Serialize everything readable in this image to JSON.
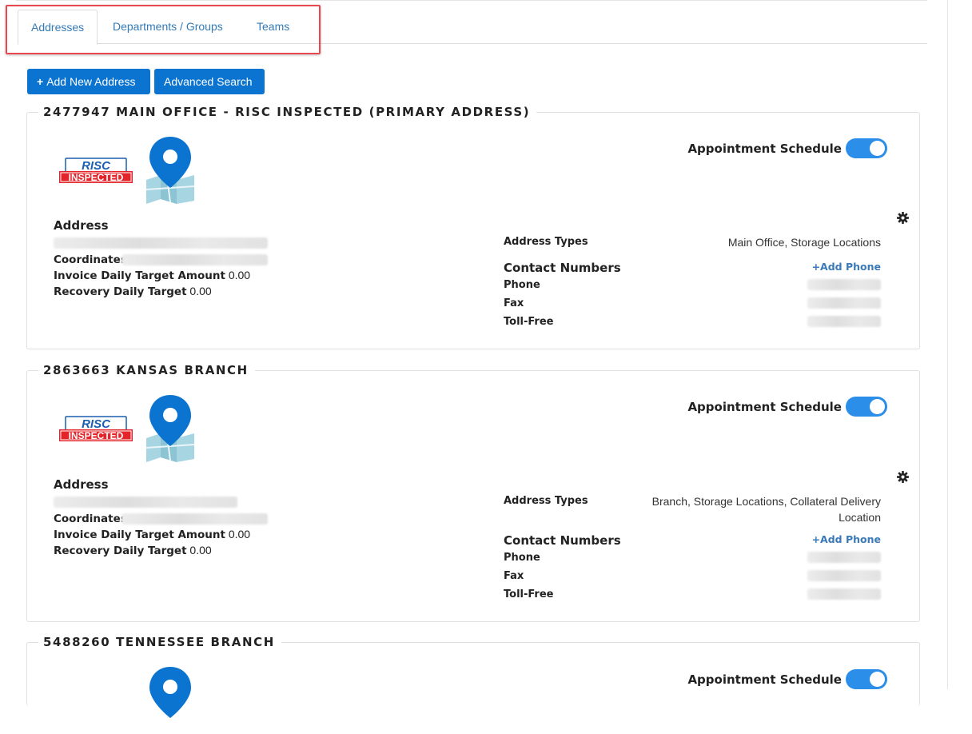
{
  "tabs": [
    {
      "label": "Addresses",
      "active": true
    },
    {
      "label": "Departments / Groups",
      "active": false
    },
    {
      "label": "Teams",
      "active": false
    }
  ],
  "toolbar": {
    "add_label": "Add New Address",
    "add_icon": "+",
    "search_label": "Advanced Search"
  },
  "colors": {
    "primary_button": "#0b74d0",
    "toggle_on": "#2b8ee8",
    "link": "#337ab7",
    "highlight_box": "#e8474f"
  },
  "risc_logo": {
    "line1": "RISC",
    "line2": "INSPECTED"
  },
  "labels": {
    "appointment_schedule": "Appointment Schedule",
    "address": "Address",
    "coordinates": "Coordinates",
    "invoice_target": "Invoice Daily Target Amount",
    "recovery_target": "Recovery Daily Target",
    "address_types": "Address Types",
    "contact_numbers": "Contact Numbers",
    "add_phone": "+Add Phone",
    "phone": "Phone",
    "fax": "Fax",
    "toll_free": "Toll-Free"
  },
  "addresses": [
    {
      "title": "2477947 MAIN OFFICE - RISC INSPECTED (PRIMARY ADDRESS)",
      "invoice_target": "0.00",
      "recovery_target": "0.00",
      "types_line1": "Main Office, Storage Locations",
      "types_line2": "",
      "appointment_schedule_on": true
    },
    {
      "title": "2863663 KANSAS BRANCH",
      "invoice_target": "0.00",
      "recovery_target": "0.00",
      "types_line1": "Branch, Storage Locations, Collateral Delivery",
      "types_line2": "Location",
      "appointment_schedule_on": true
    },
    {
      "title": "5488260 TENNESSEE BRANCH",
      "appointment_schedule_on": true
    }
  ]
}
